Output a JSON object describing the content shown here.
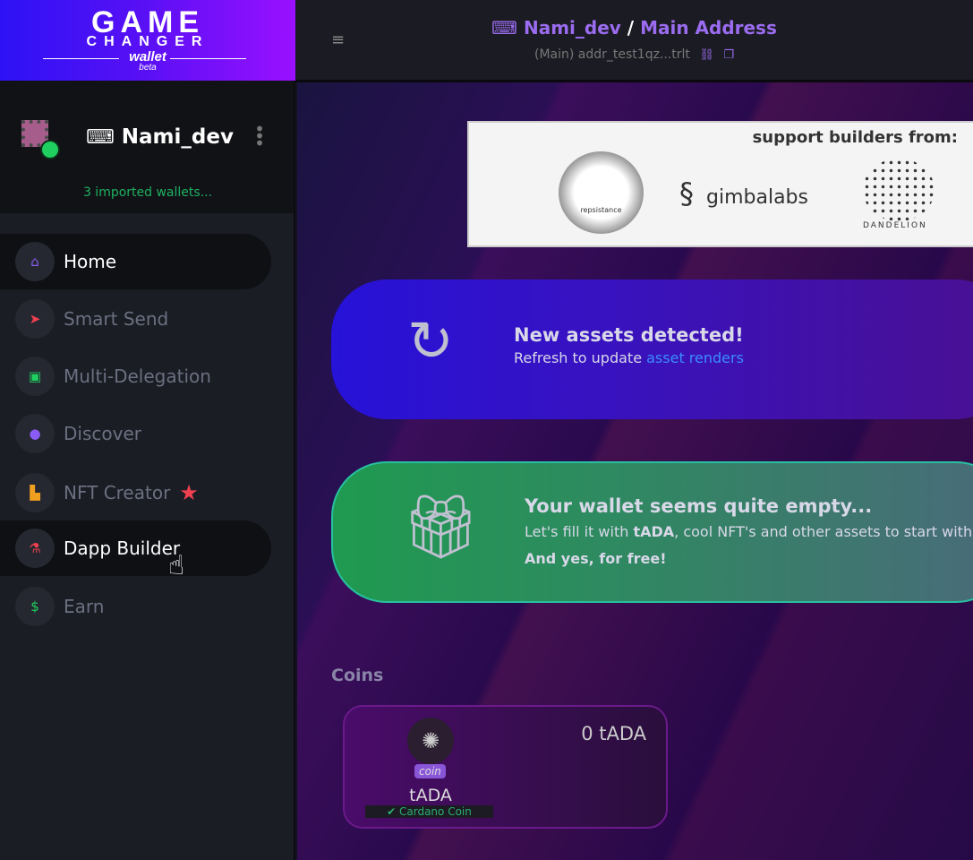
{
  "logo": {
    "line1": "GAME",
    "line2": "CHANGER",
    "line3": "wallet",
    "line4": "beta"
  },
  "wallet": {
    "name": "Nami_dev",
    "imported": "3 imported wallets..."
  },
  "nav": [
    {
      "label": "Home",
      "icon": "home-icon",
      "color": "#8a5cf5"
    },
    {
      "label": "Smart Send",
      "icon": "send-icon",
      "color": "#f04050"
    },
    {
      "label": "Multi-Delegation",
      "icon": "gift-icon",
      "color": "#1fd060"
    },
    {
      "label": "Discover",
      "icon": "globe-icon",
      "color": "#8a5cf5"
    },
    {
      "label": "NFT Creator",
      "icon": "factory-icon",
      "color": "#f0a020"
    },
    {
      "label": "Dapp Builder",
      "icon": "flask-icon",
      "color": "#f04050"
    },
    {
      "label": "Earn",
      "icon": "dollar-icon",
      "color": "#1fd060"
    }
  ],
  "topbar": {
    "wallet": "Nami_dev",
    "sep": "/",
    "address_name": "Main Address",
    "address": "(Main) addr_test1qz...trlt"
  },
  "banner": {
    "title": "support builders from:",
    "sponsors": [
      "repsistance",
      "gimbalabs",
      "DANDELION"
    ]
  },
  "refresh_card": {
    "title": "New assets detected!",
    "text": "Refresh to update ",
    "link": "asset renders"
  },
  "empty_card": {
    "title": "Your wallet seems quite empty...",
    "t1": "Let's fill it with ",
    "b1": "tADA",
    "t2": ", cool NFT's and other assets to start with! ",
    "b2": "And yes, for free!"
  },
  "coins": {
    "heading": "Coins",
    "items": [
      {
        "badge": "coin",
        "name": "tADA",
        "verified": "Cardano Coin",
        "amount": "0 tADA"
      }
    ]
  }
}
